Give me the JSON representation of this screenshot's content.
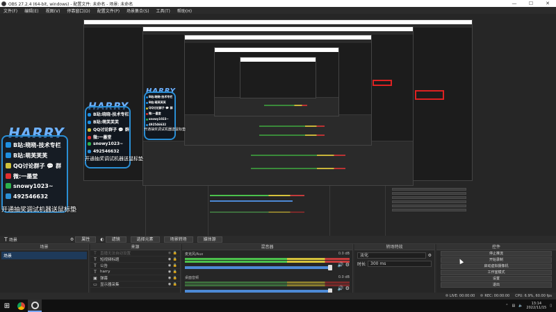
{
  "window": {
    "title": "OBS 27.2.4 (64-bit, windows) - 配置文件: 未命名 - 场景: 未命名",
    "min": "—",
    "max": "☐",
    "close": "✕"
  },
  "menu": [
    "文件(F)",
    "编辑(E)",
    "视图(V)",
    "停靠窗口(D)",
    "配置文件(P)",
    "场景集合(S)",
    "工具(T)",
    "帮助(H)"
  ],
  "overlay": {
    "logo": "HARRY",
    "lines": [
      {
        "icon": "bilibili",
        "color": "#1e8fe0",
        "text": "B站:晓晓-技术专栏"
      },
      {
        "icon": "bilibili",
        "color": "#1e8fe0",
        "text": "B站:萌芙芙芙"
      },
      {
        "icon": "qq-group",
        "color": "#d0c23a",
        "text": "QQ讨论群子 💬 群"
      },
      {
        "icon": "weibo",
        "color": "#e03030",
        "text": "微:一墨堂"
      },
      {
        "icon": "wechat",
        "color": "#2bb24c",
        "text": "snowy1023~"
      },
      {
        "icon": "qq",
        "color": "#2a8fd6",
        "text": "492546632"
      }
    ],
    "caption": "开通抽奖调试机器送鼠标垫"
  },
  "scene_bar": {
    "current_scene": "场景",
    "properties": "属性",
    "filters": "滤镜",
    "select_item": "选择元素",
    "transition_key": "场景转场",
    "source_name": "媒体源"
  },
  "scenes": {
    "header": "场景",
    "items": [
      "场景"
    ]
  },
  "sources": {
    "header": "来源",
    "items": [
      {
        "icon": "text",
        "label": "直播无法自动设置",
        "dim": true
      },
      {
        "icon": "text",
        "label": "短视频标题",
        "dim": false
      },
      {
        "icon": "text",
        "label": "公告",
        "dim": false
      },
      {
        "icon": "text",
        "label": "harry",
        "dim": false
      },
      {
        "icon": "image",
        "label": "弹幕",
        "dim": false
      },
      {
        "icon": "monitor",
        "label": "显示器采集",
        "dim": false
      }
    ]
  },
  "mixer": {
    "header": "混音器",
    "channels": [
      {
        "name": "麦克风/Aux",
        "db": "0.0 dB",
        "level": 0.58
      },
      {
        "name": "桌面音频",
        "db": "0.0 dB",
        "level": 0.0
      }
    ]
  },
  "transitions": {
    "header": "转场特效",
    "type": "淡化",
    "duration_label": "时长",
    "duration": "300 ms"
  },
  "controls": {
    "header": "控件",
    "buttons": [
      "停止推流",
      "开始录制",
      "启动虚拟摄像机",
      "工作室模式",
      "设置",
      "退出"
    ]
  },
  "status": {
    "live": "LIVE: 00:00:00",
    "rec": "REC: 00:00:00",
    "cpu": "CPU: 6.9%, 60.00 fps"
  },
  "taskbar": {
    "time": "13:14",
    "date": "2022/11/15",
    "apps": [
      "chrome",
      "obs"
    ]
  },
  "colors": {
    "accent": "#2a8fd6",
    "scene_selected": "#1e3a5a",
    "slider": "#4d8ad6",
    "meter_green": "#4cc24c",
    "meter_yellow": "#d6c33c",
    "meter_red": "#c43c3c"
  }
}
